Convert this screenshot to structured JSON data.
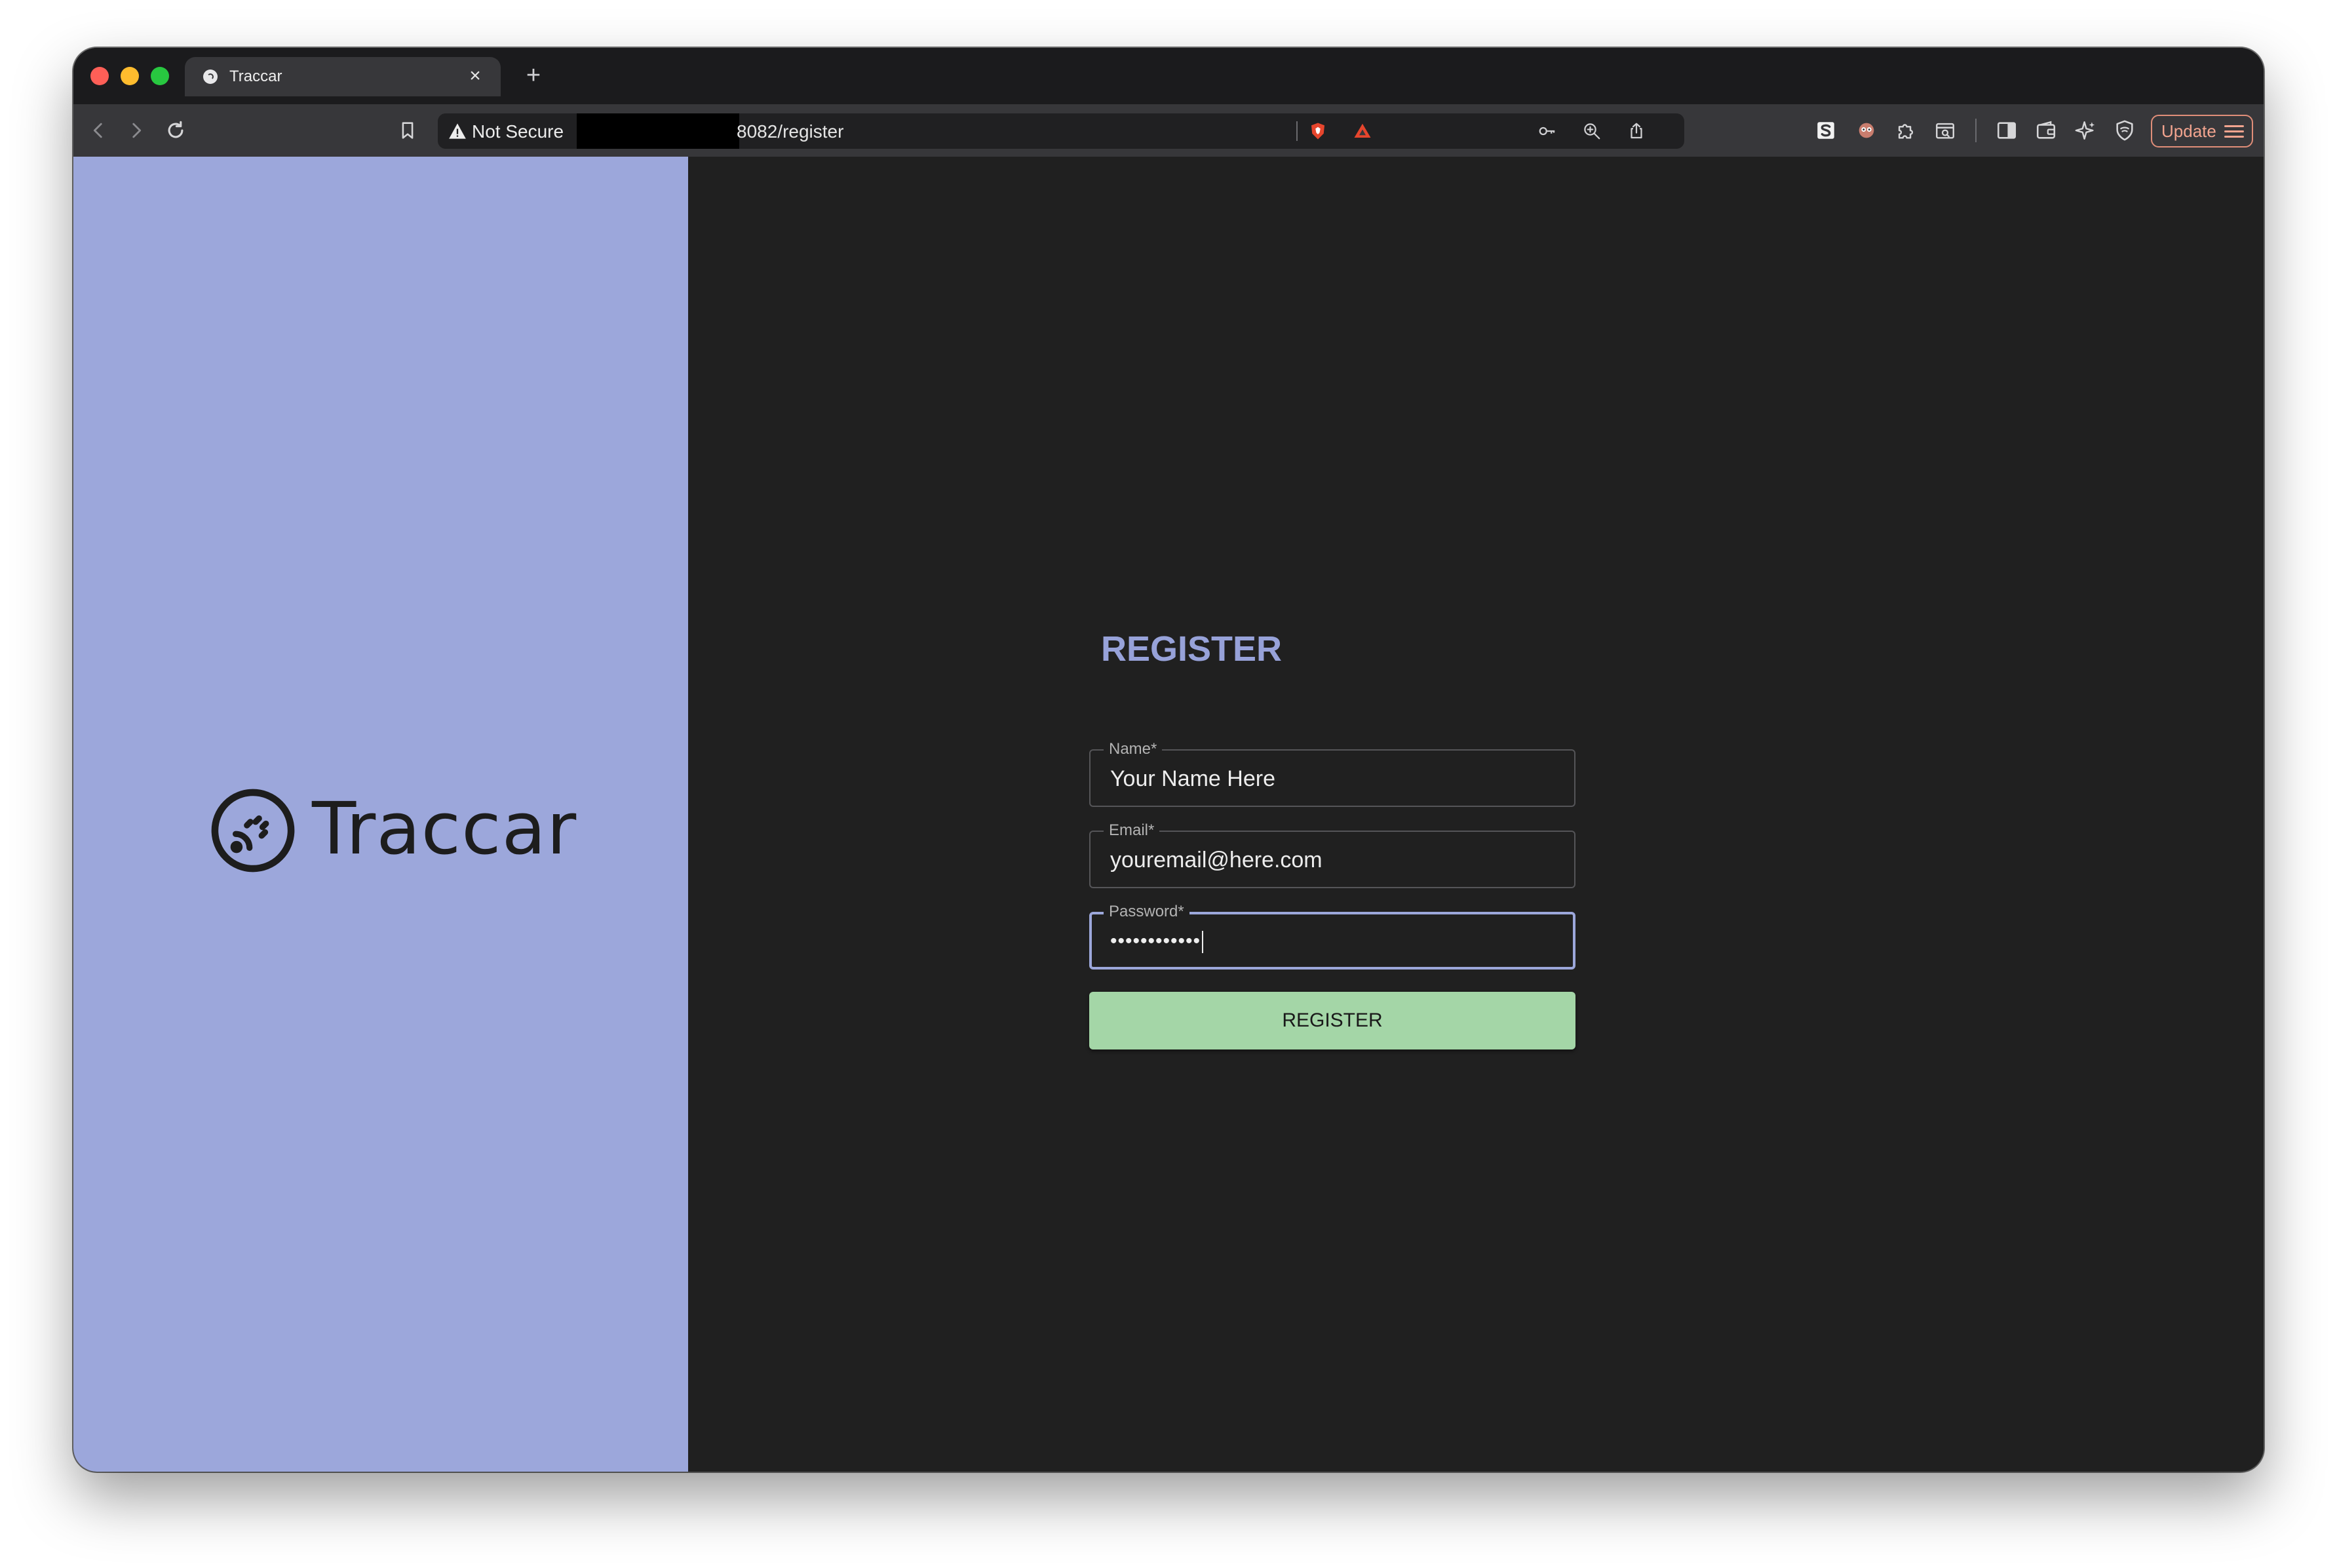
{
  "browser": {
    "tab_title": "Traccar",
    "tab_close_glyph": "×",
    "new_tab_glyph": "+",
    "security_label": "Not Secure",
    "url_visible": "8082/register",
    "update_label": "Update",
    "icons": [
      "back-icon",
      "forward-icon",
      "reload-icon",
      "bookmark-icon",
      "warning-icon",
      "key-icon",
      "zoom-icon",
      "share-icon",
      "brave-shields-icon",
      "brave-rewards-icon",
      "extension-s-icon",
      "extension-mask-icon",
      "extensions-puzzle-icon",
      "extension-reader-icon",
      "sidebar-icon",
      "wallet-icon",
      "leo-ai-icon",
      "vpn-icon",
      "menu-icon"
    ]
  },
  "brand": {
    "logo_text": "Traccar",
    "panel_color": "#9ca7db"
  },
  "form": {
    "title": "REGISTER",
    "fields": [
      {
        "label": "Name*",
        "value": "Your Name Here"
      },
      {
        "label": "Email*",
        "value": "youremail@here.com"
      },
      {
        "label": "Password*",
        "value": "••••••••••••"
      }
    ],
    "submit_label": "REGISTER",
    "accent_color": "#97a2d9",
    "button_color": "#a4d6a7"
  }
}
